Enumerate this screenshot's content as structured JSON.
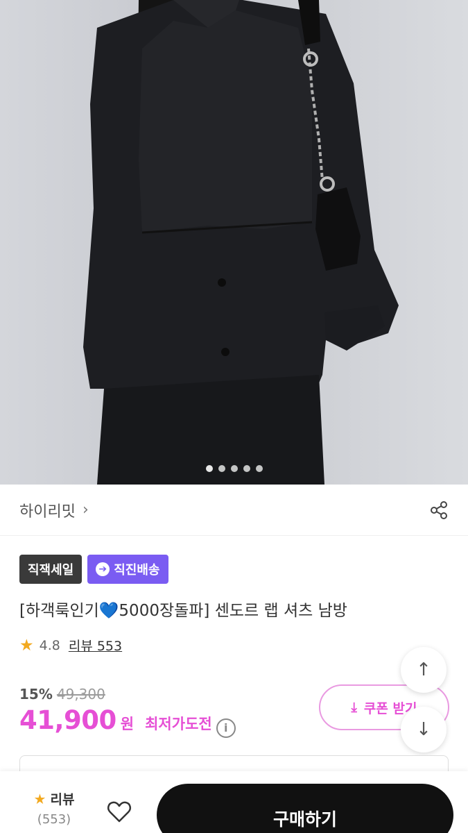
{
  "gallery": {
    "image_alt": "product photo",
    "slide_count": 5,
    "active_slide": 1
  },
  "brand": {
    "name": "하이리밋",
    "chevron": "›"
  },
  "badges": [
    {
      "label": "직잭세일",
      "style": "dark"
    },
    {
      "label": "직진배송",
      "style": "purple",
      "icon": "arrow-circle-icon"
    }
  ],
  "product": {
    "title_prefix": "[하객룩인기",
    "title_heart": "💙",
    "title_suffix": "5000장돌파] 센도르 랩 셔츠 남방",
    "rating": "4.8",
    "reviews_label": "리뷰 553"
  },
  "pricing": {
    "discount": "15%",
    "original_price": "49,300",
    "price": "41,900",
    "currency": "원",
    "lowest_label": "최저가도전",
    "info_symbol": "i"
  },
  "coupon": {
    "label": "쿠폰 받기",
    "icon": "download-icon"
  },
  "floating": {
    "scroll_up_icon": "arrow-up-icon",
    "scroll_down_icon": "arrow-down-icon"
  },
  "bottom_bar": {
    "review_label": "리뷰",
    "review_count": "(553)",
    "buy_label": "구매하기"
  },
  "colors": {
    "accent_pink": "#e64fd5",
    "badge_purple": "#7a5cf2",
    "star": "#f2a91f"
  }
}
